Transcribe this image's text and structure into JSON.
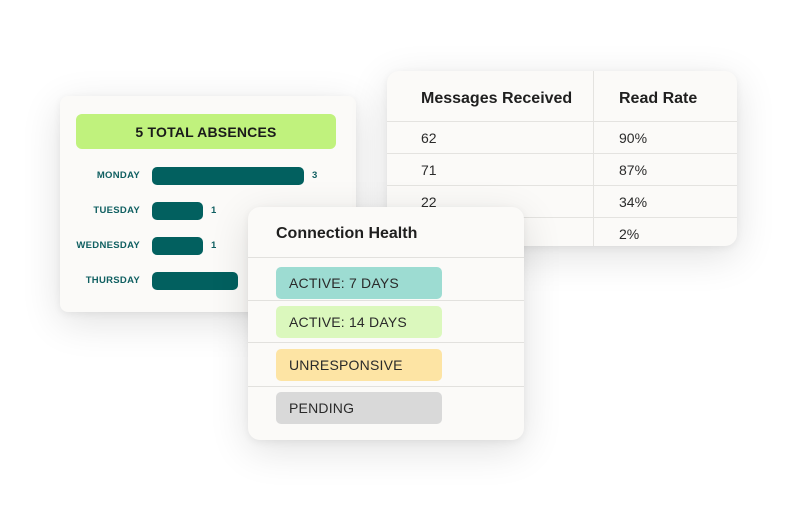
{
  "absences": {
    "title": "5 TOTAL ABSENCES",
    "banner_color": "#c0f27d",
    "bar_color": "#02605f",
    "max_value": 3,
    "days": [
      {
        "label": "MONDAY",
        "value": 3,
        "value_label": "3"
      },
      {
        "label": "TUESDAY",
        "value": 1,
        "value_label": "1"
      },
      {
        "label": "WEDNESDAY",
        "value": 1,
        "value_label": "1"
      },
      {
        "label": "THURSDAY",
        "value": 1.7,
        "value_label": null
      }
    ]
  },
  "messages_table": {
    "columns": [
      "Messages Received",
      "Read Rate"
    ],
    "rows": [
      [
        "62",
        "90%"
      ],
      [
        "71",
        "87%"
      ],
      [
        "22",
        "34%"
      ],
      [
        "",
        "2%"
      ]
    ]
  },
  "connection_health": {
    "title": "Connection Health",
    "statuses": [
      {
        "label": "ACTIVE: 7 DAYS",
        "color": "#9ddcd2"
      },
      {
        "label": "ACTIVE: 14 DAYS",
        "color": "#dbf8bd"
      },
      {
        "label": "UNRESPONSIVE",
        "color": "#fde4a4"
      },
      {
        "label": "PENDING",
        "color": "#d9d9d9"
      }
    ]
  }
}
